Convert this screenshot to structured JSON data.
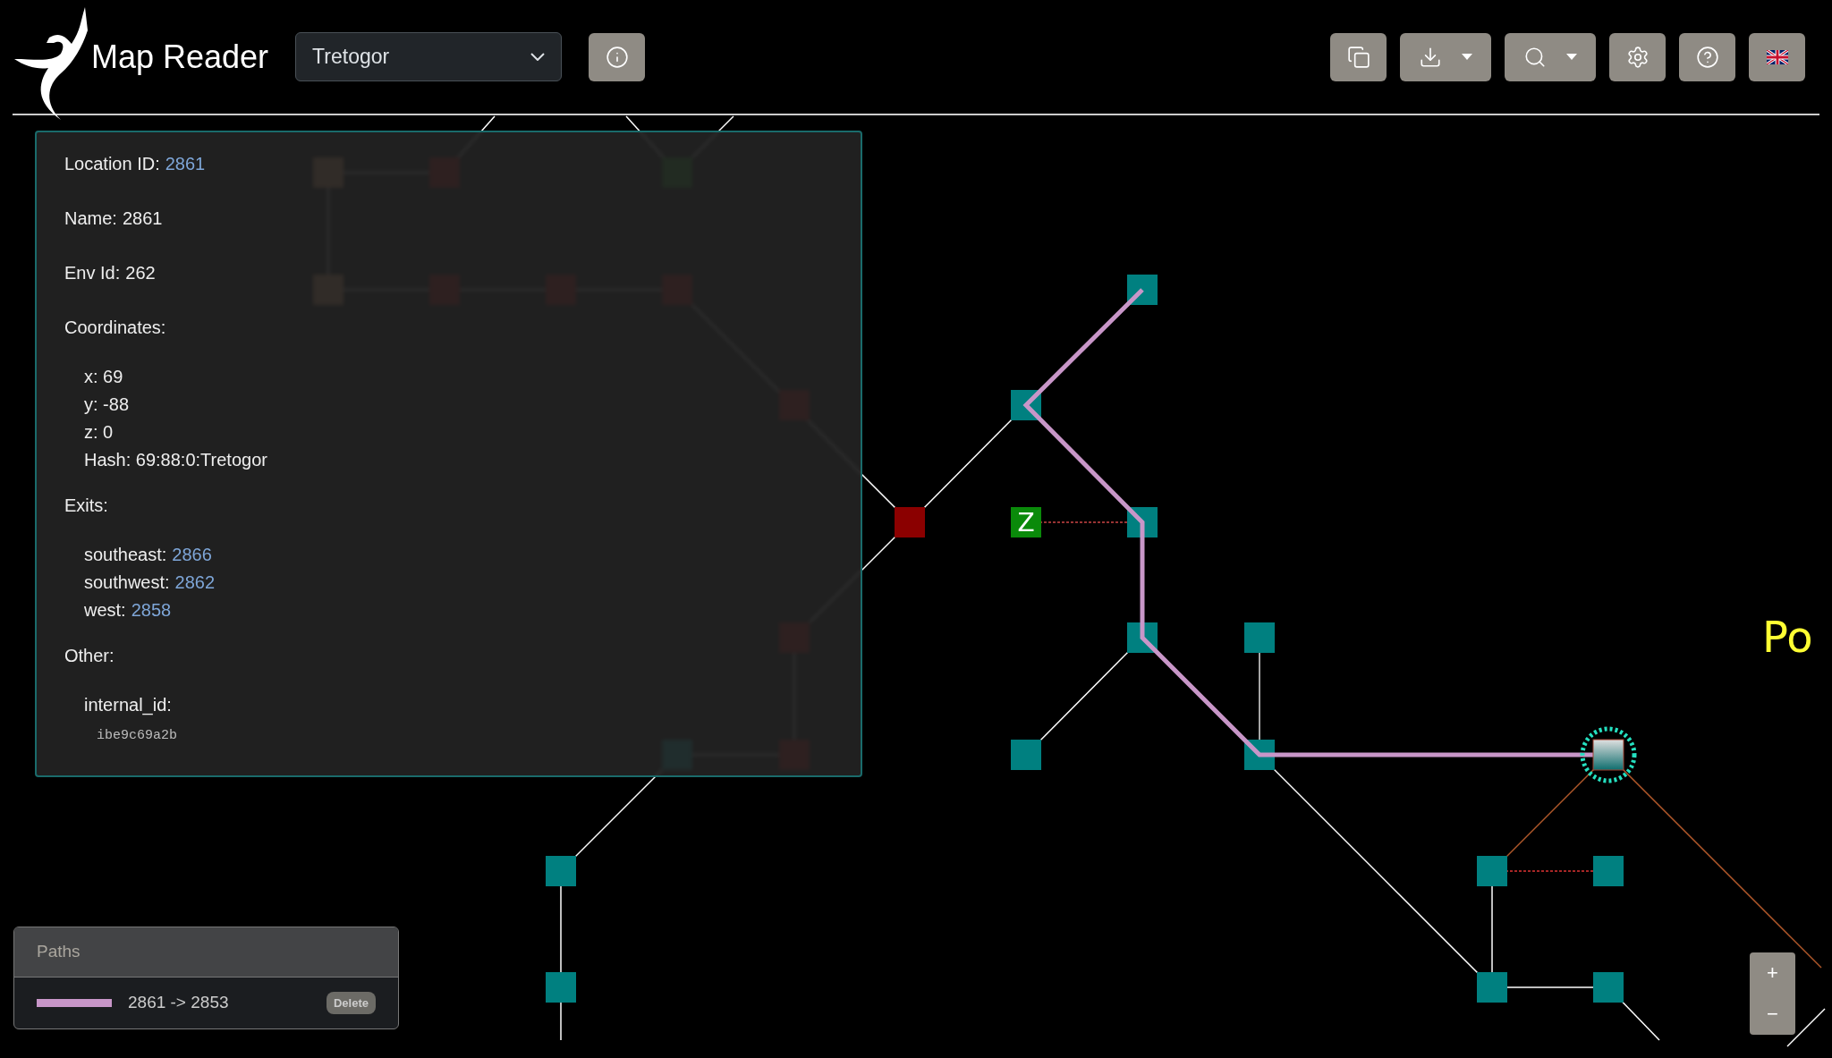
{
  "header": {
    "title": "Map Reader",
    "map_select": {
      "value": "Tretogor"
    }
  },
  "location_panel": {
    "fields": [
      {
        "label": "Location ID:",
        "value": "2861",
        "kind": "link"
      },
      {
        "label": "Name:",
        "value": "2861",
        "kind": "plain"
      },
      {
        "label": "Env Id:",
        "value": "262",
        "kind": "plain"
      }
    ],
    "coordinates": {
      "label": "Coordinates:",
      "items": [
        "x: 69",
        "y: -88",
        "z: 0",
        "Hash: 69:88:0:Tretogor"
      ]
    },
    "exits": {
      "label": "Exits:",
      "items": [
        {
          "direction": "southeast:",
          "target": "2866"
        },
        {
          "direction": "southwest:",
          "target": "2862"
        },
        {
          "direction": "west:",
          "target": "2858"
        }
      ]
    },
    "other": {
      "label": "Other:",
      "items": [
        {
          "key": "internal_id:",
          "value": "ibe9c69a2b"
        }
      ]
    }
  },
  "map": {
    "marker_text": "Z",
    "area_label": "Po"
  },
  "paths": {
    "title": "Paths",
    "items": [
      {
        "label": "2861 -> 2853",
        "color": "#c896c8",
        "action": "Delete"
      }
    ]
  },
  "zoom": {
    "zoom_in": "+",
    "zoom_out": "−"
  }
}
